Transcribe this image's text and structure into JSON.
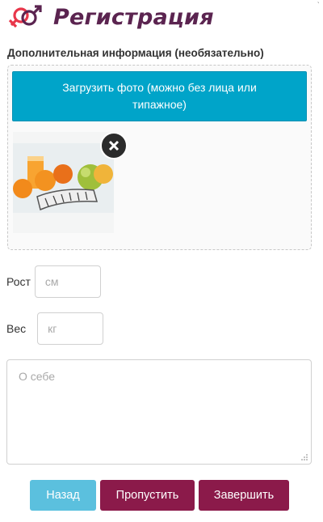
{
  "header": {
    "title": "Регистрация",
    "logo_icon": "male-female-symbols-icon",
    "accent_color": "#5b2450"
  },
  "section": {
    "label": "Дополнительная информация (необязательно)"
  },
  "upload": {
    "button_label": "Загрузить фото (можно без лица или типажное)",
    "button_color": "#00a4c9",
    "photo_icon": "fruit-photo-thumbnail",
    "remove_icon": "close-icon"
  },
  "fields": {
    "height": {
      "label": "Рост",
      "placeholder": "см",
      "value": ""
    },
    "weight": {
      "label": "Вес",
      "placeholder": "кг",
      "value": ""
    },
    "about": {
      "placeholder": "О себе",
      "value": ""
    }
  },
  "buttons": {
    "back_label": "Назад",
    "skip_label": "Пропустить",
    "finish_label": "Завершить",
    "back_color": "#5bc0de",
    "primary_color": "#8b1a4a"
  }
}
